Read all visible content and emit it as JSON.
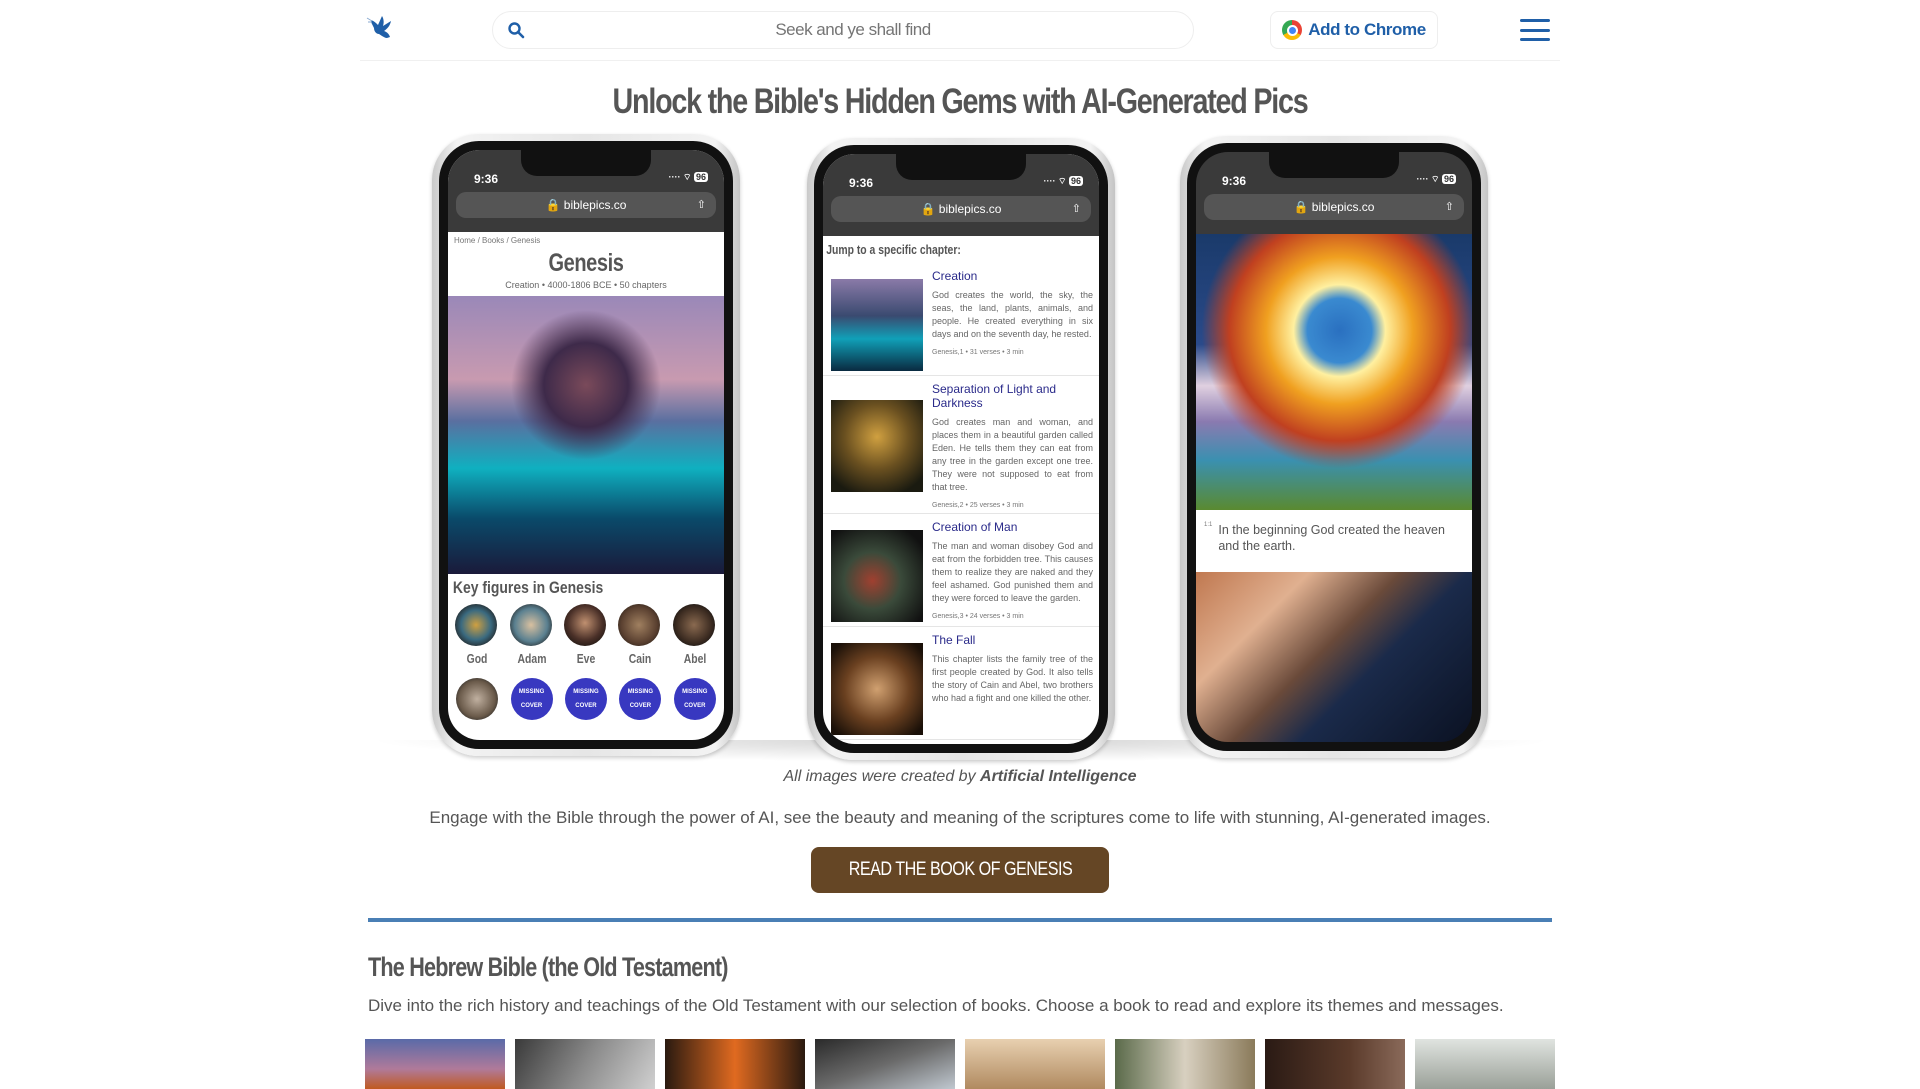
{
  "header": {
    "logo": "dove-logo",
    "search_placeholder": "Seek and ye shall find",
    "add_to_chrome": "Add to Chrome",
    "menu_icon": "hamburger-icon",
    "brand_color": "#1f5fa8"
  },
  "hero": {
    "title": "Unlock the Bible's Hidden Gems with AI-Generated Pics"
  },
  "phones": {
    "time": "9:36",
    "battery": "96",
    "url": "biblepics.co",
    "p1": {
      "breadcrumb": "Home / Books / Genesis",
      "title": "Genesis",
      "subtitle": "Creation • 4000-1806 BCE • 50 chapters",
      "key_figures_title": "Key figures in Genesis",
      "figures": [
        {
          "name": "God"
        },
        {
          "name": "Adam"
        },
        {
          "name": "Eve"
        },
        {
          "name": "Cain"
        },
        {
          "name": "Abel"
        }
      ],
      "missing_line1": "MISSING",
      "missing_line2": "COVER"
    },
    "p2": {
      "jump_title": "Jump to a specific chapter:",
      "chapters": [
        {
          "title": "Creation",
          "desc": "God creates the world, the sky, the seas, the land, plants, animals, and people. He created everything in six days and on the seventh day, he rested.",
          "meta": "Genesis,1 • 31 verses • 3 min"
        },
        {
          "title": "Separation of Light and Darkness",
          "desc": "God creates man and woman, and places them in a beautiful garden called Eden. He tells them they can eat from any tree in the garden except one tree. They were not supposed to eat from that tree.",
          "meta": "Genesis,2 • 25 verses • 3 min"
        },
        {
          "title": "Creation of Man",
          "desc": "The man and woman disobey God and eat from the forbidden tree. This causes them to realize they are naked and they feel ashamed. God punished them and they were forced to leave the garden.",
          "meta": "Genesis,3 • 24 verses • 3 min"
        },
        {
          "title": "The Fall",
          "desc": "This chapter lists the family tree of the first people created by God. It also tells the story of Cain and Abel, two brothers who had a fight and one killed the other.",
          "meta": ""
        }
      ]
    },
    "p3": {
      "verse_num": "1:1",
      "verse": "In the beginning God created the heaven and the earth."
    }
  },
  "caption": {
    "prefix": "All images were created by ",
    "bold": "Artificial Intelligence"
  },
  "lead": "Engage with the Bible through the power of AI, see the beauty and meaning of the scriptures come to life with stunning, AI-generated images.",
  "cta": {
    "label": "READ THE BOOK OF GENESIS",
    "color": "#654625"
  },
  "section": {
    "title": "The Hebrew Bible (the Old Testament)",
    "desc": "Dive into the rich history and teachings of the Old Testament with our selection of books. Choose a book to read and explore its themes and messages.",
    "rule_color": "#4a7fb5"
  }
}
